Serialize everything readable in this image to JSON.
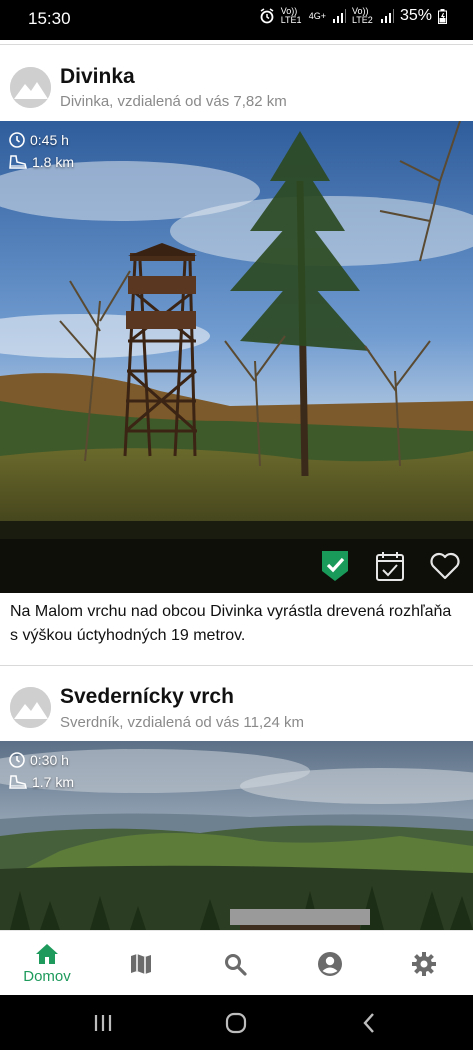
{
  "status_bar": {
    "time": "15:30",
    "sim1": "Vo)) LTE1",
    "net": "4G+",
    "sim2": "Vo)) LTE2",
    "battery": "35%"
  },
  "places": [
    {
      "title": "Divinka",
      "subtitle": "Divinka, vzdialená od vás 7,82 km",
      "duration": "0:45 h",
      "distance": "1.8 km",
      "description": "Na Malom vrchu nad obcou Divinka vyrástla drevená rozhľaňa s výškou úctyhodných 19 metrov.",
      "visited": true
    },
    {
      "title": "Svederníсky vrch",
      "subtitle": "Sverdník, vzdialená od vás 11,24 km",
      "duration": "0:30 h",
      "distance": "1.7 km"
    }
  ],
  "bottom_nav": {
    "items": [
      {
        "label": "Domov",
        "icon": "home-icon",
        "active": true
      },
      {
        "label": "",
        "icon": "map-icon"
      },
      {
        "label": "",
        "icon": "search-icon"
      },
      {
        "label": "",
        "icon": "account-icon"
      },
      {
        "label": "",
        "icon": "settings-icon"
      }
    ]
  },
  "colors": {
    "accent": "#1e9a5c",
    "visited_badge": "#1a9a5a"
  }
}
